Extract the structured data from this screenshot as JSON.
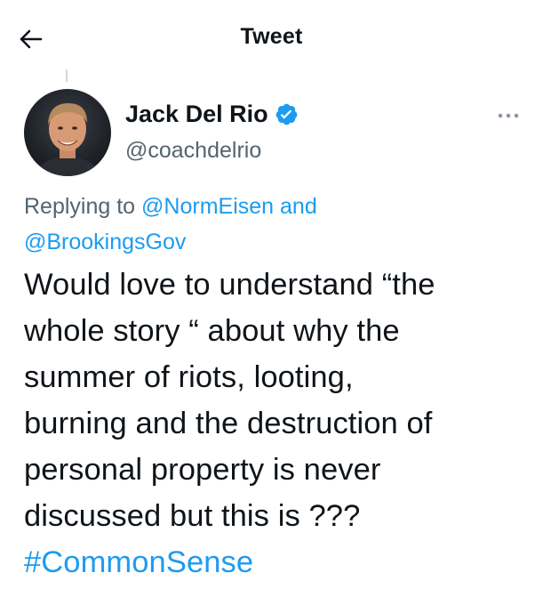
{
  "header": {
    "title": "Tweet",
    "back_icon": "arrow-left-icon"
  },
  "author": {
    "display_name": "Jack Del Rio",
    "handle": "@coachdelrio",
    "verified_icon": "verified-badge-icon",
    "verified_color": "#1d9bf0"
  },
  "more_icon": "more-horizontal-icon",
  "replying": {
    "prefix": "Replying to",
    "mention_1": "@NormEisen",
    "conjunction": "and",
    "mention_2": "@BrookingsGov"
  },
  "tweet": {
    "lines": [
      "Would love to understand “the",
      "whole story “ about why the",
      "summer of riots, looting,",
      "burning and the destruction of",
      "personal property is never",
      "discussed but this is ???"
    ],
    "hashtag": "#CommonSense"
  },
  "colors": {
    "link": "#1d9bf0",
    "secondary_text": "#536471",
    "primary_text": "#0f1419"
  }
}
